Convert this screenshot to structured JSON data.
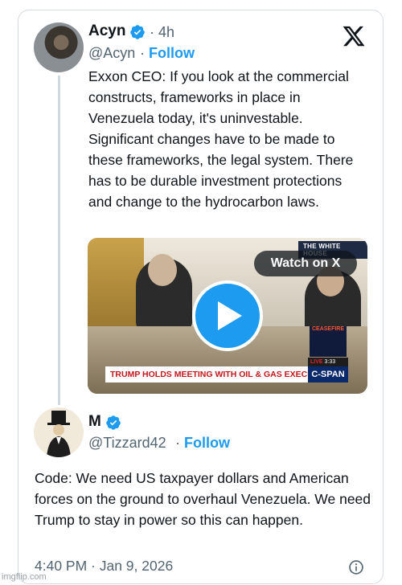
{
  "post": {
    "author_name": "Acyn",
    "handle": "@Acyn",
    "time_ago": "4h",
    "follow_label": "Follow",
    "text": "Exxon CEO: If you look at the commercial constructs, frameworks in place in Venezuela today, it's uninvestable. Significant changes have to be made to these frameworks, the legal system. There has to be durable investment protections and change to the hydrocarbon laws.",
    "video": {
      "watch_label": "Watch on X",
      "source_label": "THE WHITE HOUSE",
      "chyron": "TRUMP HOLDS MEETING WITH OIL & GAS EXECUTIVES",
      "network": "C-SPAN",
      "live_label": "LIVE",
      "live_time": "3:33",
      "inset_label": "CEASEFIRE"
    }
  },
  "quote": {
    "author_name": "M",
    "handle": "@Tizzard42",
    "follow_label": "Follow",
    "text": "Code: We need US taxpayer dollars and American forces on the ground to overhaul Venezuela.  We need Trump to stay in power so this can happen.",
    "timestamp": "4:40 PM · Jan 9, 2026"
  },
  "watermark": "imgflip.com",
  "colors": {
    "accent": "#1d9bf0",
    "text": "#0f1419",
    "muted": "#536471"
  },
  "icons": [
    "verified-badge-icon",
    "x-logo-icon",
    "play-icon",
    "info-icon"
  ]
}
